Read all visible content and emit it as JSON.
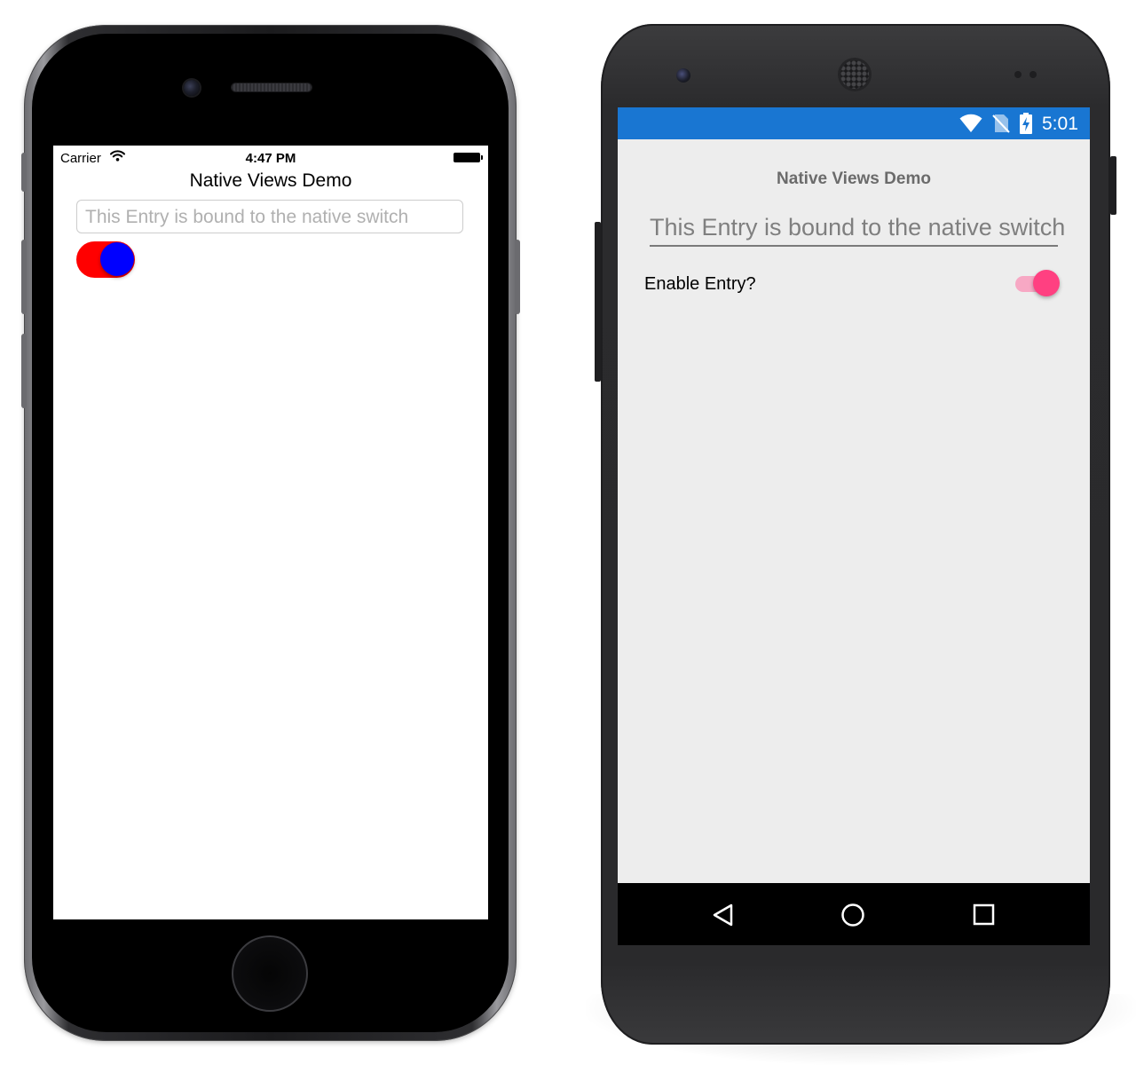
{
  "ios": {
    "status_bar": {
      "carrier": "Carrier",
      "time": "4:47 PM"
    },
    "nav_title": "Native Views Demo",
    "entry_placeholder": "This Entry is bound to the native switch",
    "native_switch": {
      "on": true,
      "track_color": "#ff0000",
      "thumb_color": "#0000ff"
    }
  },
  "android": {
    "status_bar": {
      "time": "5:01",
      "background_color": "#1976d2"
    },
    "page_title": "Native Views Demo",
    "entry_placeholder": "This Entry is bound to the native switch",
    "switch_label": "Enable Entry?",
    "native_switch": {
      "on": true,
      "thumb_color": "#ff4081",
      "track_color": "#f7a8c4"
    },
    "nav_bar": [
      "back-icon",
      "home-icon",
      "overview-icon"
    ]
  }
}
